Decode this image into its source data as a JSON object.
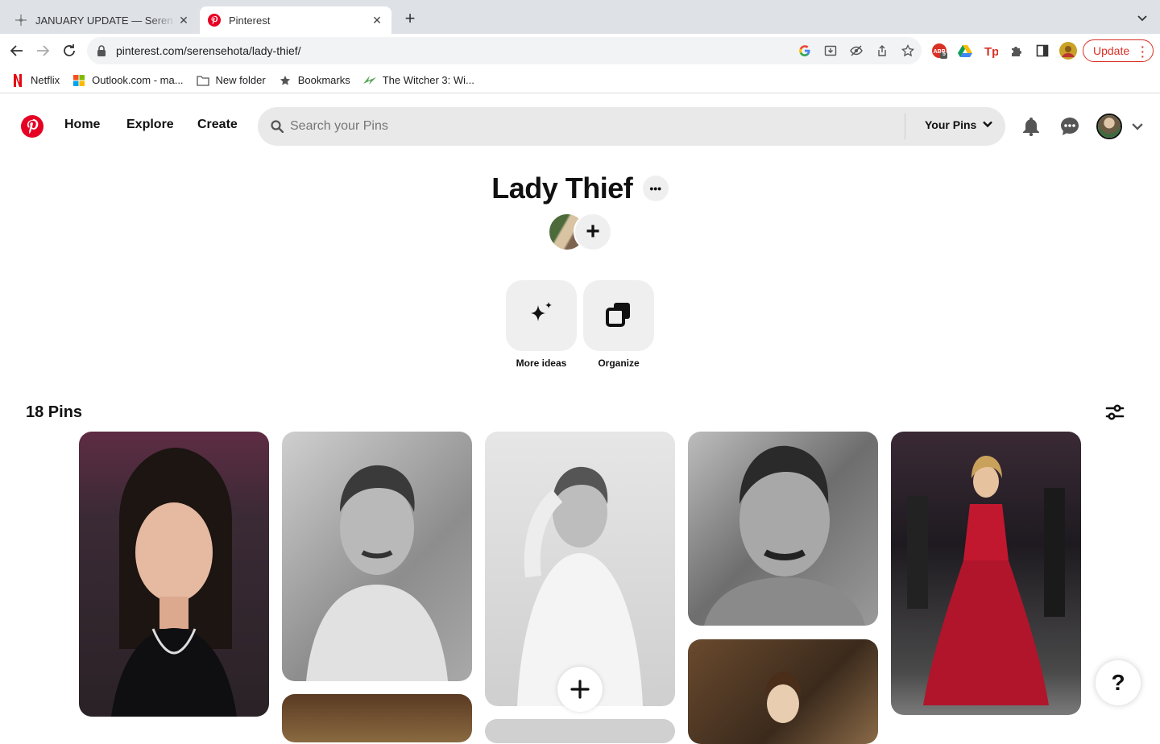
{
  "browser": {
    "tabs": [
      {
        "title": "JANUARY UPDATE — Seren Ra",
        "active": false
      },
      {
        "title": "Pinterest",
        "active": true
      }
    ],
    "url": "pinterest.com/serensehota/lady-thief/",
    "update_label": "Update",
    "extension_badge": "5",
    "bookmarks": [
      {
        "label": "Netflix",
        "icon": "netflix-icon"
      },
      {
        "label": "Outlook.com - ma...",
        "icon": "microsoft-icon"
      },
      {
        "label": "New folder",
        "icon": "folder-icon"
      },
      {
        "label": "Bookmarks",
        "icon": "star-icon"
      },
      {
        "label": "The Witcher 3: Wi...",
        "icon": "witcher-icon"
      }
    ]
  },
  "pinterest": {
    "nav": {
      "home": "Home",
      "explore": "Explore",
      "create": "Create"
    },
    "search_placeholder": "Search your Pins",
    "your_pins": "Your Pins",
    "board": {
      "title": "Lady Thief",
      "more_label": "•••",
      "add_collaborator": "+",
      "tools": [
        {
          "label": "More ideas",
          "icon": "sparkle-icon"
        },
        {
          "label": "Organize",
          "icon": "organize-icon"
        }
      ],
      "pin_count_label": "18 Pins"
    },
    "help_label": "?",
    "accent": "#e60023"
  }
}
